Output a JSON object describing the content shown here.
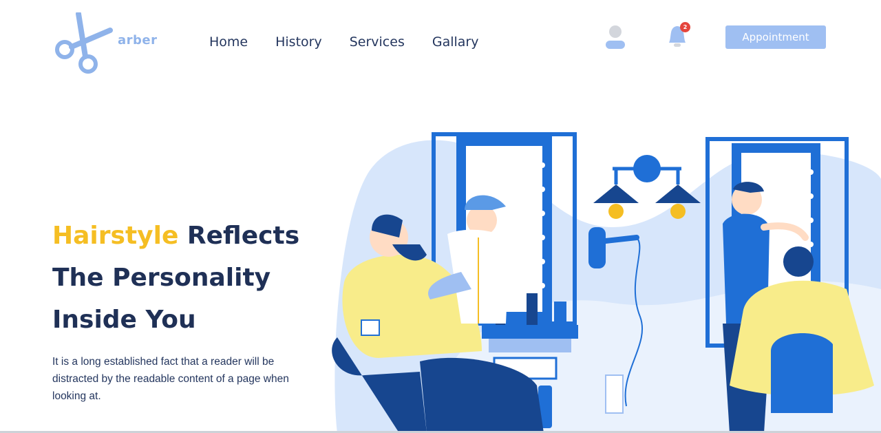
{
  "brand": {
    "name": "arber",
    "icon": "scissors-icon"
  },
  "nav": {
    "items": [
      {
        "label": "Home"
      },
      {
        "label": "History"
      },
      {
        "label": "Services"
      },
      {
        "label": "Gallary"
      }
    ]
  },
  "header": {
    "user_icon": "user-icon",
    "bell_icon": "bell-icon",
    "notification_count": "2",
    "appointment_label": "Appointment"
  },
  "hero": {
    "title_accent": "Hairstyle",
    "title_rest_1": " Reflects",
    "title_line_2": "The Personality",
    "title_line_3": "Inside You",
    "description": "It is a long established fact that a reader will be distracted by the readable content of a page when looking at."
  },
  "colors": {
    "accent_yellow": "#f5be23",
    "primary_blue": "#1f6fd6",
    "light_blue": "#9fbff2",
    "text_dark": "#1f3056"
  }
}
